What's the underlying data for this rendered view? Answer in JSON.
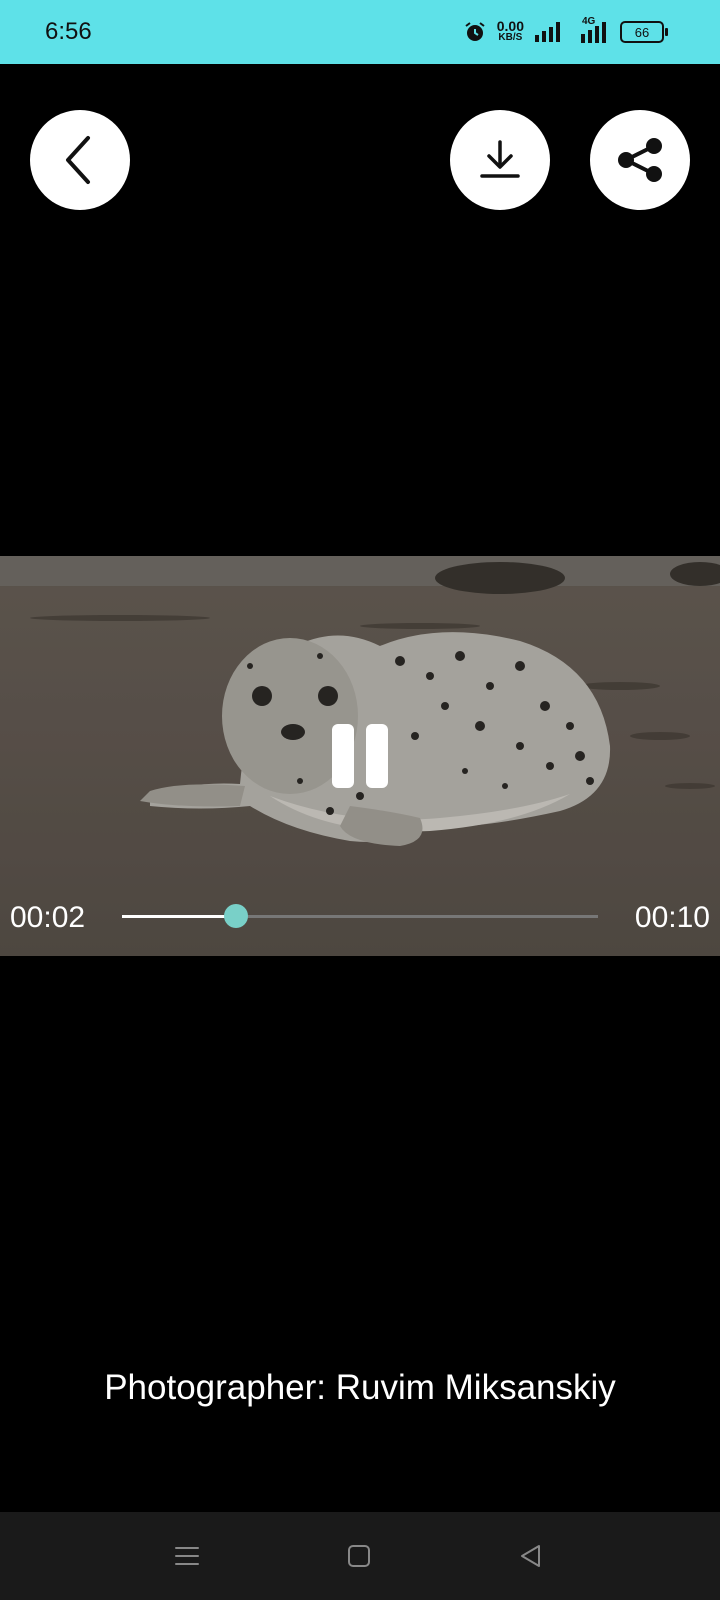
{
  "status_bar": {
    "time": "6:56",
    "net_speed_value": "0.00",
    "net_speed_unit": "KB/S",
    "network_type": "4G",
    "battery": "66"
  },
  "icons": {
    "back": "chevron-left-icon",
    "download": "download-icon",
    "share": "share-icon",
    "pause": "pause-icon"
  },
  "player": {
    "current_time": "00:02",
    "total_time": "00:10",
    "progress": 0.24,
    "accent_color": "#79d0c8"
  },
  "credit": "Photographer: Ruvim Miksanskiy"
}
